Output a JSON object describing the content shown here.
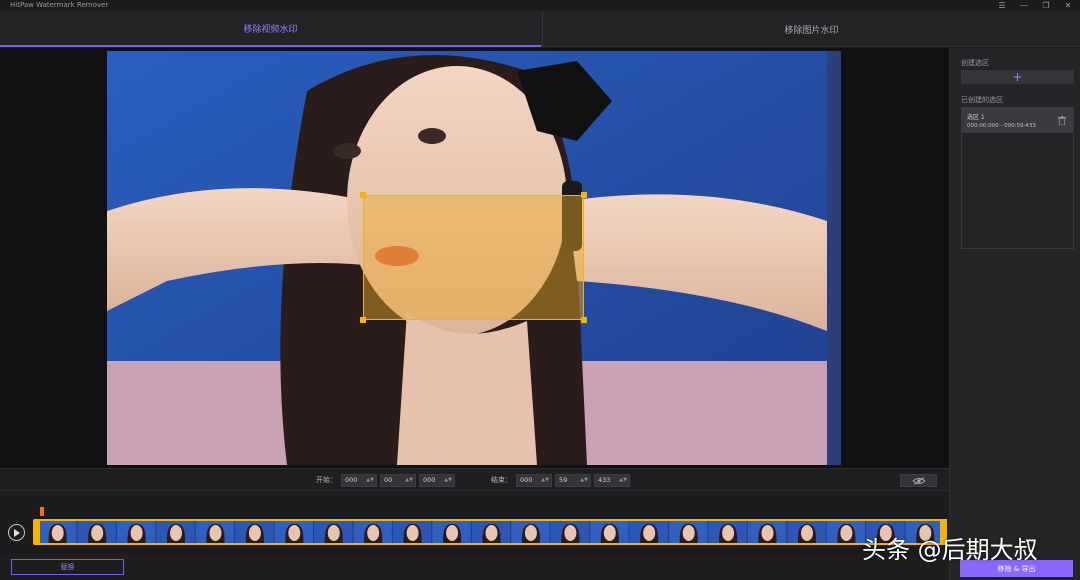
{
  "app": {
    "title": "HitPaw Watermark Remover",
    "window_controls": [
      "☰",
      "—",
      "❐",
      "✕"
    ]
  },
  "tabs": [
    {
      "label": "移除视频水印",
      "active": true
    },
    {
      "label": "移除图片水印",
      "active": false
    }
  ],
  "side_panel": {
    "create_label": "创建选区",
    "add_icon": "+",
    "created_label": "已创建的选区",
    "areas": [
      {
        "name": "选区 1",
        "time": "000:00:000 - 000:59:433"
      }
    ]
  },
  "time_range": {
    "start_label": "开始：",
    "start": [
      "000",
      "00",
      "000"
    ],
    "end_label": "结束：",
    "end": [
      "000",
      "59",
      "433"
    ]
  },
  "timeline": {
    "frame_count": 23
  },
  "buttons": {
    "replace": "替换",
    "export": "移除 & 导出"
  },
  "overlay": {
    "watermark_text": "头条 @后期大叔"
  },
  "colors": {
    "accent": "#8b66ff",
    "selection": "#f5b400",
    "playhead": "#ff6a13"
  }
}
